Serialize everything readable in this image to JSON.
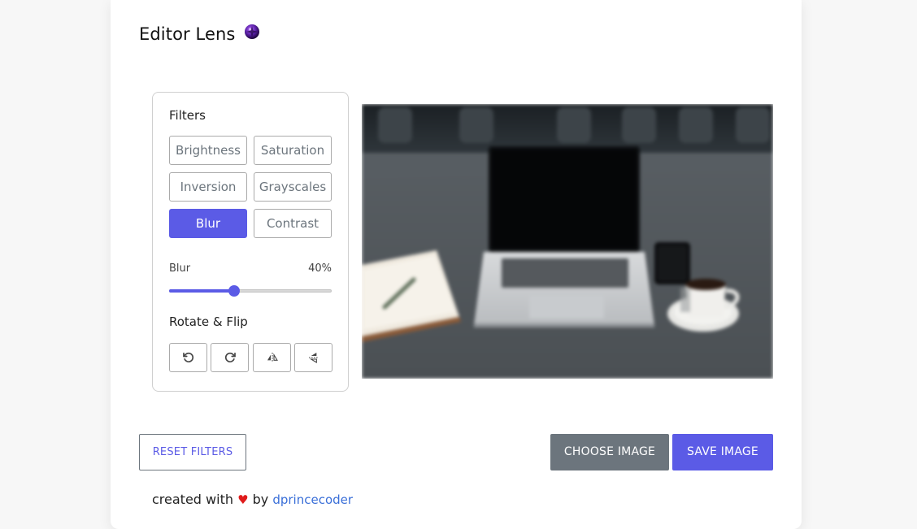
{
  "app": {
    "title": "Editor Lens",
    "logo_icon": "purple-orb-icon"
  },
  "filters": {
    "heading": "Filters",
    "buttons": [
      {
        "label": "Brightness",
        "active": false
      },
      {
        "label": "Saturation",
        "active": false
      },
      {
        "label": "Inversion",
        "active": false
      },
      {
        "label": "Grayscales",
        "active": false
      },
      {
        "label": "Blur",
        "active": true
      },
      {
        "label": "Contrast",
        "active": false
      }
    ],
    "slider": {
      "name": "Blur",
      "value_text": "40%",
      "value": 0.4
    }
  },
  "rotate_flip": {
    "heading": "Rotate & Flip",
    "buttons": [
      {
        "icon": "rotate-left-icon"
      },
      {
        "icon": "rotate-right-icon"
      },
      {
        "icon": "flip-horizontal-icon"
      },
      {
        "icon": "flip-vertical-icon"
      }
    ]
  },
  "preview": {
    "subject_icon": "laptop-desk-photo"
  },
  "actions": {
    "reset": "RESET FILTERS",
    "choose": "CHOOSE IMAGE",
    "save": "SAVE IMAGE"
  },
  "footer": {
    "prefix": "created with",
    "heart": "♥",
    "middle": "by",
    "author": "dprincecoder"
  },
  "colors": {
    "accent": "#5b5be6",
    "secondary": "#6c757d",
    "heart": "#e01b1b",
    "link": "#3a6fd8"
  }
}
